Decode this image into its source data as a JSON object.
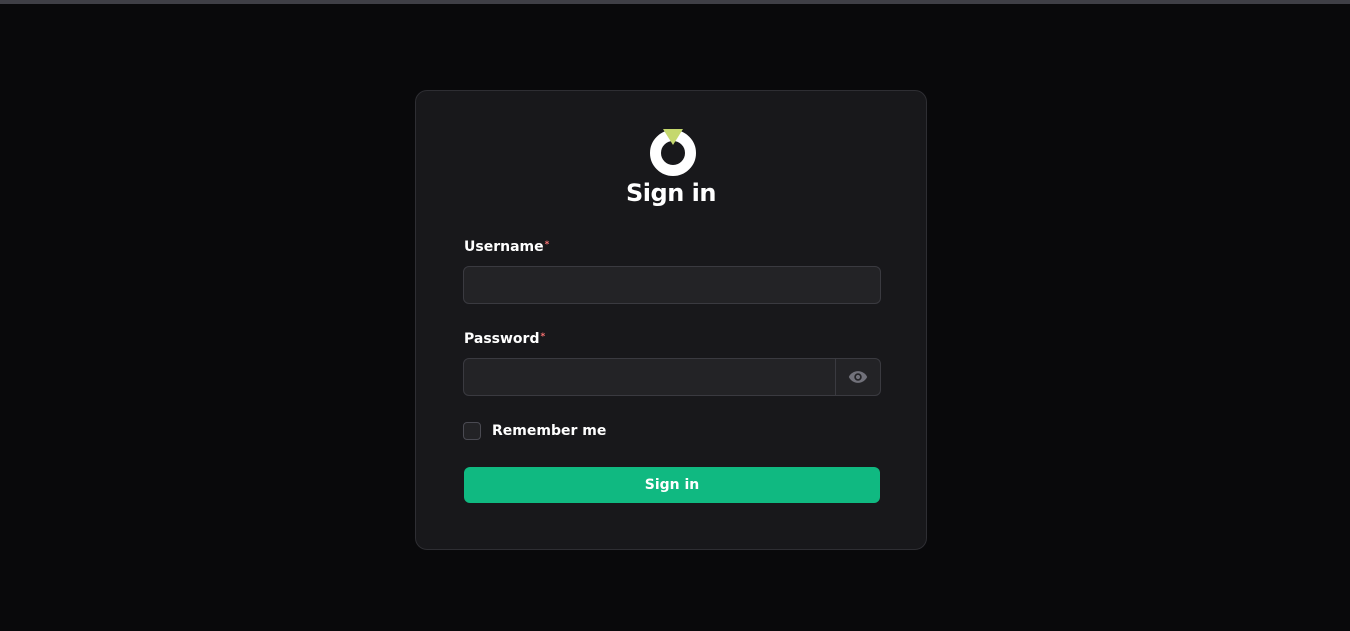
{
  "form": {
    "title": "Sign in",
    "username_label": "Username",
    "username_value": "",
    "password_label": "Password",
    "password_value": "",
    "required_marker": "*",
    "remember_label": "Remember me",
    "remember_checked": false,
    "submit_label": "Sign in"
  },
  "icons": {
    "logo": "ring-logo-icon",
    "password_toggle": "eye-icon"
  },
  "colors": {
    "background": "#09090b",
    "card": "#18181b",
    "accent": "#10b981",
    "logo_gem": "#c5d86d",
    "required": "#f87171"
  }
}
